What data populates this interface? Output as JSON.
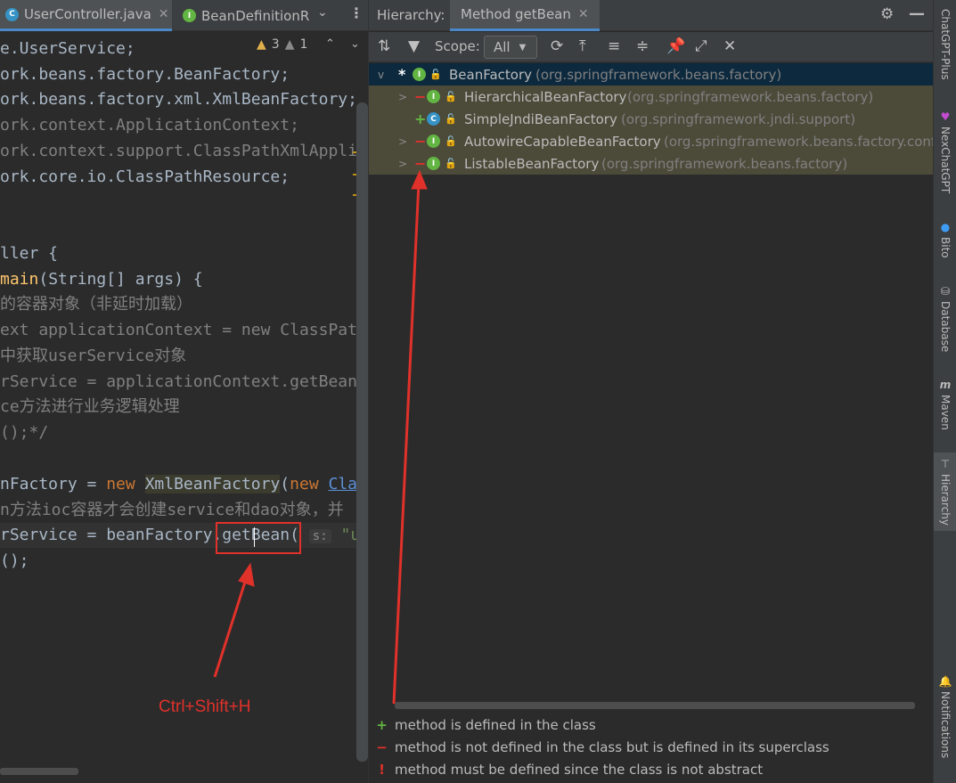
{
  "editor": {
    "tabs": [
      {
        "label": "UserController.java",
        "icon": "class-c-icon"
      },
      {
        "label": "BeanDefinitionR",
        "icon": "interface-i-icon"
      }
    ],
    "inspections": {
      "warnings": "3",
      "weak_warnings": "1"
    },
    "code_lines": [
      [
        "e.UserService;"
      ],
      [
        "ork.beans.factory.BeanFactory;"
      ],
      [
        "ork.beans.factory.xml.XmlBeanFactory;"
      ],
      [
        "ork.context.ApplicationContext;"
      ],
      [
        "ork.context.support.ClassPathXmlApplic"
      ],
      [
        "ork.core.io.ClassPathResource;"
      ],
      [
        "ller {"
      ],
      [
        "main",
        "(String[] args) {"
      ],
      [
        "的容器对象（非延时加载）"
      ],
      [
        "ext applicationContext = new ClassPat"
      ],
      [
        "中获取userService对象"
      ],
      [
        "rService = applicationContext.getBean("
      ],
      [
        "ce方法进行业务逻辑处理"
      ],
      [
        "();*/"
      ],
      [
        "nFactory = ",
        "new",
        " ",
        "XmlBeanFactory",
        "(",
        "new",
        " ",
        "Clas"
      ],
      [
        "n方法ioc容器才会创建service和dao对象，并"
      ],
      [
        "rService = beanFactory.",
        "getBean",
        "(",
        " ",
        "s:",
        " ",
        "\"use"
      ],
      [
        "();"
      ]
    ]
  },
  "annotation": {
    "label": "Ctrl+Shift+H"
  },
  "hierarchy": {
    "title": "Hierarchy:",
    "tab_label": "Method getBean",
    "scope_label": "Scope:",
    "scope_value": "All",
    "tree": [
      {
        "mark": "*",
        "icon": "I",
        "name": "BeanFactory",
        "package": "(org.springframework.beans.factory)",
        "expand": "v"
      },
      {
        "mark": "−",
        "icon": "I",
        "name": "HierarchicalBeanFactory",
        "package": "(org.springframework.beans.factory)",
        "expand": ">"
      },
      {
        "mark": "+",
        "icon": "C",
        "name": "SimpleJndiBeanFactory",
        "package": "(org.springframework.jndi.support)",
        "expand": ""
      },
      {
        "mark": "−",
        "icon": "I",
        "name": "AutowireCapableBeanFactory",
        "package": "(org.springframework.beans.factory.confi",
        "expand": ">"
      },
      {
        "mark": "−",
        "icon": "I",
        "name": "ListableBeanFactory",
        "package": "(org.springframework.beans.factory)",
        "expand": ">"
      }
    ],
    "legend": [
      {
        "symbol": "+",
        "text": "method is defined in the class",
        "color": "#62b543"
      },
      {
        "symbol": "−",
        "text": "method is not defined in the class but is defined in its superclass",
        "color": "#e0312a"
      },
      {
        "symbol": "!",
        "text": "method must be defined since the class is not abstract",
        "color": "#e0312a"
      }
    ]
  },
  "right_stripe": [
    {
      "label": "ChatGPT-Plus",
      "icon": ""
    },
    {
      "label": "NexChatGPT",
      "icon": "nexchat-icon"
    },
    {
      "label": "Bito",
      "icon": "bito-icon"
    },
    {
      "label": "Database",
      "icon": "database-icon"
    },
    {
      "label": "Maven",
      "icon": "maven-icon"
    },
    {
      "label": "Hierarchy",
      "icon": "hierarchy-icon"
    },
    {
      "label": "Notifications",
      "icon": "bell-icon"
    }
  ],
  "colors": {
    "accent": "#4a88c7",
    "annotation": "#e0312a",
    "interface_icon": "#62b543",
    "class_icon": "#3592c4"
  }
}
